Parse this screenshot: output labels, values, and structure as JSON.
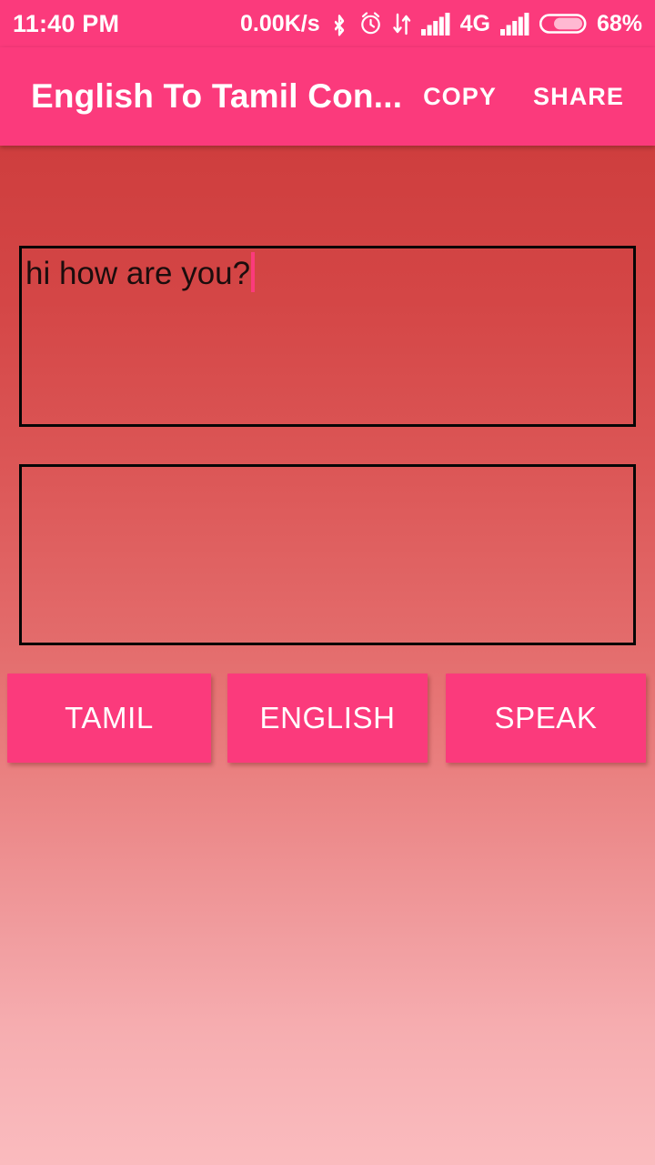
{
  "status_bar": {
    "time": "11:40 PM",
    "network_speed": "0.00K/s",
    "network_type": "4G",
    "battery_percent": "68%",
    "icons": [
      "bluetooth-icon",
      "alarm-clock-icon",
      "data-transfer-icon",
      "signal-bars-icon-1",
      "signal-bars-icon-2",
      "battery-icon"
    ],
    "background_color": "#fb3a7c",
    "foreground_color": "#ffffff"
  },
  "app_bar": {
    "title": "English To Tamil Con...",
    "actions": [
      {
        "label": "COPY"
      },
      {
        "label": "SHARE"
      }
    ],
    "background_color": "#fb3a7c",
    "title_color": "#ffffff"
  },
  "input_box": {
    "value": "hi how are you?",
    "placeholder": "",
    "caret_visible": true,
    "caret_color": "#fb3a7c",
    "border_color": "#060606"
  },
  "output_box": {
    "value": "",
    "placeholder": "",
    "border_color": "#060606"
  },
  "buttons": [
    {
      "label": "TAMIL"
    },
    {
      "label": "ENGLISH"
    },
    {
      "label": "SPEAK"
    }
  ],
  "theme": {
    "accent": "#fb3a7c",
    "background_top": "#c93636",
    "background_bottom": "#fabbbe",
    "button_text": "#ffffff"
  }
}
